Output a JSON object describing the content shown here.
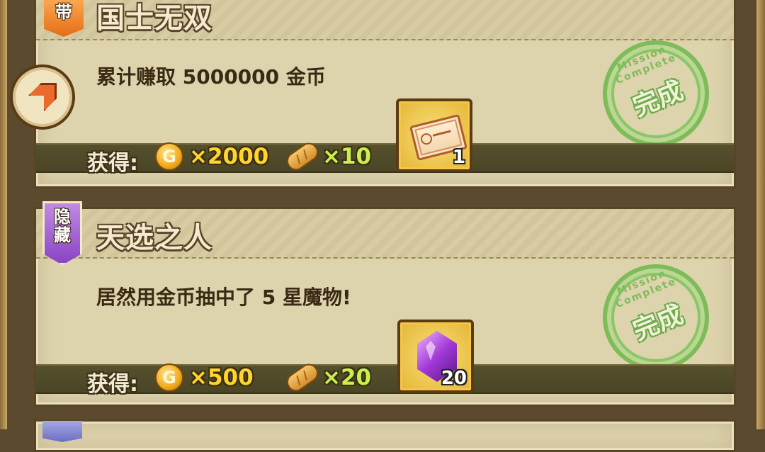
{
  "missions": [
    {
      "badge": "带",
      "title": "国士无双",
      "description": "累计赚取 5000000 金币",
      "reward_label": "获得:",
      "coin_glyph": "G",
      "coin_amount": "×2000",
      "bread_amount": "×10",
      "item_icon": "ticket-icon",
      "item_count": "1",
      "stamp_ring": "Mission Complete",
      "stamp_text": "完成"
    },
    {
      "badge": "隐藏",
      "title": "天选之人",
      "description": "居然用金币抽中了 5 星魔物!",
      "reward_label": "获得:",
      "coin_glyph": "G",
      "coin_amount": "×500",
      "bread_amount": "×20",
      "item_icon": "purple-gem-icon",
      "item_count": "20",
      "stamp_ring": "Mission Complete",
      "stamp_text": "完成"
    }
  ],
  "colors": {
    "gold_text": "#ffd52a",
    "green_text": "#c9f04a",
    "stamp_green": "#6db84a",
    "badge_orange": "#e36d16",
    "badge_purple": "#8a44c4"
  }
}
